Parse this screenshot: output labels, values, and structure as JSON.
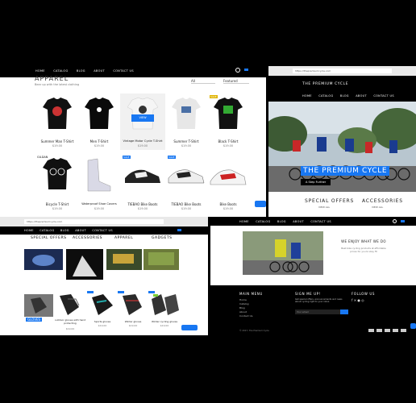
{
  "apparel_page": {
    "nav": [
      "HOME",
      "CATALOG",
      "BLOG",
      "ABOUT",
      "CONTACT US"
    ],
    "title": "APPAREL",
    "subtitle": "Bear up with the latest clothing",
    "filter_value": "All",
    "sort_value": "Featured",
    "products": [
      {
        "name": "Summer Man T-Shirt",
        "price": "$19.00"
      },
      {
        "name": "Men T-Shirt",
        "price": "$19.00"
      },
      {
        "name": "Vintage Motor Cycle T-Shirt",
        "price": "$19.00"
      },
      {
        "name": "Summer T-Shirt",
        "price": "$19.00"
      },
      {
        "name": "Black T-Shirt",
        "price": "$19.00"
      },
      {
        "name": "Bicycle T-Shirt",
        "price": "$19.00"
      },
      {
        "name": "Waterproof Shoe Covers",
        "price": "$19.00"
      },
      {
        "name": "TIEBAO Bike Boots",
        "price": "$19.00"
      },
      {
        "name": "TIEBAO Bike Boots",
        "price": "$19.00"
      },
      {
        "name": "Bike Boots",
        "price": "$19.00"
      }
    ],
    "view_label": "VIEW",
    "sale_label": "SALE",
    "logo_badge": "GILDAN"
  },
  "hero_page": {
    "url": "https://thepremiumcycle.com",
    "brand": "THE PREMIUM CYCLE",
    "nav": [
      "HOME",
      "CATALOG",
      "BLOG",
      "ABOUT",
      "CONTACT US"
    ],
    "hero_title": "THE PREMIUM CYCLE",
    "hero_button": "A Step Further",
    "special_offers": "SPECIAL OFFERS",
    "special_offers_link": "VIEW ALL",
    "accessories": "ACCESSORIES",
    "accessories_link": "VIEW ALL"
  },
  "collections_page": {
    "url": "https://thepremiumcycle.com",
    "nav": [
      "HOME",
      "CATALOG",
      "BLOG",
      "ABOUT",
      "CONTACT US"
    ],
    "categories": [
      "SPECIAL OFFERS",
      "ACCESSORIES",
      "APPAREL",
      "GADGETS"
    ],
    "products": [
      {
        "name": "",
        "price": ""
      },
      {
        "name": "outdoor gloves with hand protecting",
        "price": "$19.00"
      },
      {
        "name": "Sports gloves",
        "price": "$19.00"
      },
      {
        "name": "Winter gloves",
        "price": "$19.00"
      },
      {
        "name": "Winter cycling gloves",
        "price": "$19.00"
      }
    ],
    "gloves_label": "GLOVES"
  },
  "about_page": {
    "nav": [
      "HOME",
      "CATALOG",
      "BLOG",
      "ABOUT",
      "CONTACT US"
    ],
    "enjoy_title": "WE ENJOY WHAT WE DO",
    "enjoy_text": "Best bike cycling products at affordable prices for you to stay fit",
    "footer": {
      "main_menu_title": "MAIN MENU",
      "main_menu": [
        "Home",
        "Catalog",
        "Blog",
        "About",
        "Contact Us"
      ],
      "signup_title": "SIGN ME UP!",
      "signup_text": "Get special offers, announcements and news about cycling right to your inbox.",
      "email_placeholder": "Your email",
      "follow_title": "FOLLOW US",
      "copyright": "© 2017, The Premium Cycle"
    }
  },
  "colors": {
    "accent": "#1877f2",
    "dark": "#000000"
  }
}
